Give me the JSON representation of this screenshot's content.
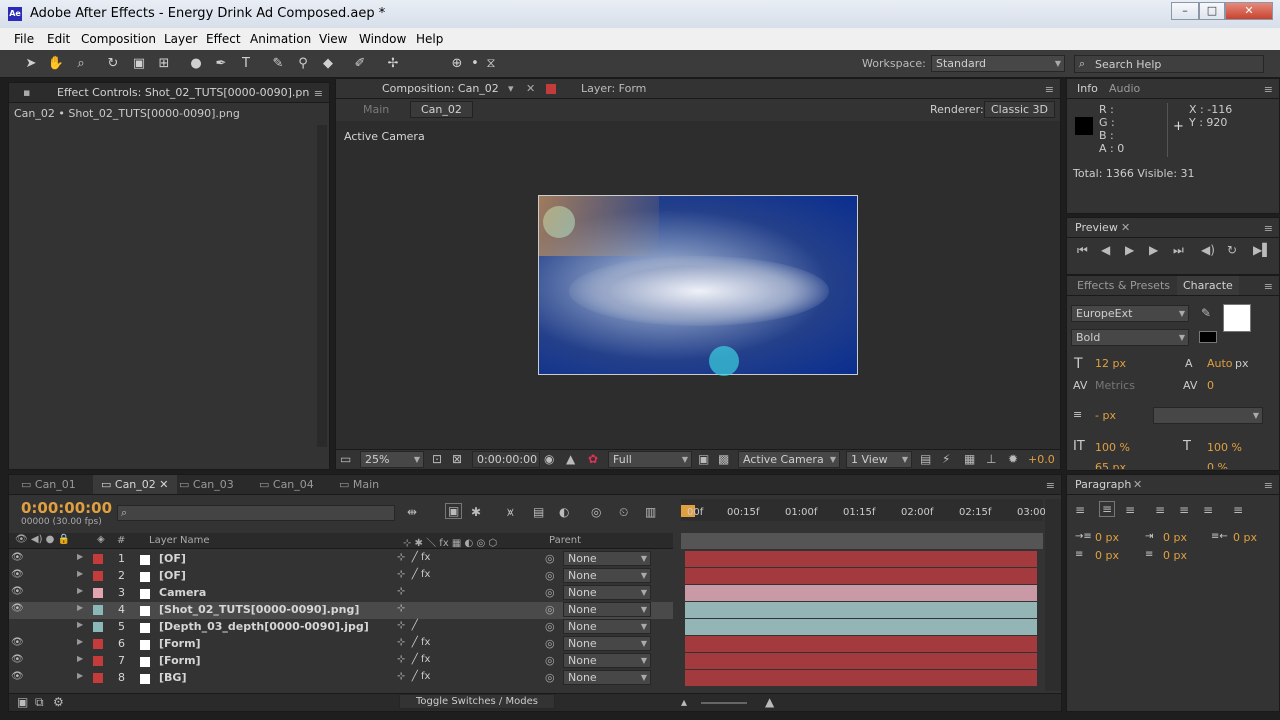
{
  "app": {
    "title": "Adobe After Effects - Energy Drink Ad Composed.aep *",
    "logo": "Ae"
  },
  "menu": [
    "File",
    "Edit",
    "Composition",
    "Layer",
    "Effect",
    "Animation",
    "View",
    "Window",
    "Help"
  ],
  "toolbar": {
    "workspace_label": "Workspace:",
    "workspace_value": "Standard",
    "search_placeholder": "Search Help"
  },
  "effect_controls": {
    "tab": "Effect Controls: Shot_02_TUTS[0000-0090].pn",
    "subtitle": "Can_02 • Shot_02_TUTS[0000-0090].png"
  },
  "comp": {
    "tab": "Composition: Can_02",
    "layer_tab": "Layer: Form",
    "crumb_main": "Main",
    "crumb_active": "Can_02",
    "renderer_label": "Renderer:",
    "renderer_value": "Classic 3D",
    "active_camera": "Active Camera",
    "footer": {
      "zoom": "25%",
      "time": "0:00:00:00",
      "resolution": "Full",
      "view": "Active Camera",
      "views": "1 View",
      "offset": "+0.0"
    }
  },
  "info": {
    "tab1": "Info",
    "tab2": "Audio",
    "r": "R :",
    "g": "G :",
    "b": "B :",
    "a": "A : 0",
    "x": "X : -116",
    "y": "Y : 920",
    "total": "Total: 1366  Visible: 31"
  },
  "preview": {
    "tab": "Preview"
  },
  "character": {
    "tab1": "Effects & Presets",
    "tab2": "Characte",
    "font": "EuropeExt",
    "style": "Bold",
    "size": "12 px",
    "leading": "Auto",
    "leading_unit": "px",
    "kerning": "Metrics",
    "tracking": "0",
    "stroke": "- px",
    "vscale": "100 %",
    "hscale": "100 %",
    "baseline": "65 px",
    "tsume": "0 %"
  },
  "paragraph": {
    "tab": "Paragraph",
    "indent1": "0 px",
    "indent2": "0 px",
    "indent3": "0 px",
    "space1": "0 px",
    "space2": "0 px"
  },
  "timeline": {
    "tabs": [
      "Can_01",
      "Can_02",
      "Can_03",
      "Can_04",
      "Main"
    ],
    "active_tab": 1,
    "timecode": "0:00:00:00",
    "frames": "00000 (30.00 fps)",
    "col_layer": "Layer Name",
    "col_num": "#",
    "col_parent": "Parent",
    "toggle": "Toggle Switches / Modes",
    "ruler": [
      "00f",
      "00:15f",
      "01:00f",
      "01:15f",
      "02:00f",
      "02:15f",
      "03:00"
    ],
    "layers": [
      {
        "num": "1",
        "name": "[OF]",
        "label": "#c33b3b",
        "fx": "fx",
        "parent": "None",
        "bar": "#a33a3e",
        "selected": false,
        "eye": true
      },
      {
        "num": "2",
        "name": "[OF]",
        "label": "#c33b3b",
        "fx": "fx",
        "parent": "None",
        "bar": "#a33a3e",
        "selected": false,
        "eye": true
      },
      {
        "num": "3",
        "name": "Camera",
        "label": "#e2a4b0",
        "fx": "",
        "parent": "None",
        "bar": "#c99aa5",
        "selected": false,
        "eye": true
      },
      {
        "num": "4",
        "name": "[Shot_02_TUTS[0000-0090].png]",
        "label": "#8ab8b8",
        "fx": "",
        "parent": "None",
        "bar": "#93b5b5",
        "selected": true,
        "eye": true
      },
      {
        "num": "5",
        "name": "[Depth_03_depth[0000-0090].jpg]",
        "label": "#8ab8b8",
        "fx": "",
        "parent": "None",
        "bar": "#93b5b5",
        "selected": false,
        "eye": false
      },
      {
        "num": "6",
        "name": "[Form]",
        "label": "#c33b3b",
        "fx": "fx",
        "parent": "None",
        "bar": "#a33a3e",
        "selected": false,
        "eye": true
      },
      {
        "num": "7",
        "name": "[Form]",
        "label": "#c33b3b",
        "fx": "fx",
        "parent": "None",
        "bar": "#a33a3e",
        "selected": false,
        "eye": true
      },
      {
        "num": "8",
        "name": "[BG]",
        "label": "#c33b3b",
        "fx": "fx",
        "parent": "None",
        "bar": "#a33a3e",
        "selected": false,
        "eye": true
      }
    ]
  }
}
